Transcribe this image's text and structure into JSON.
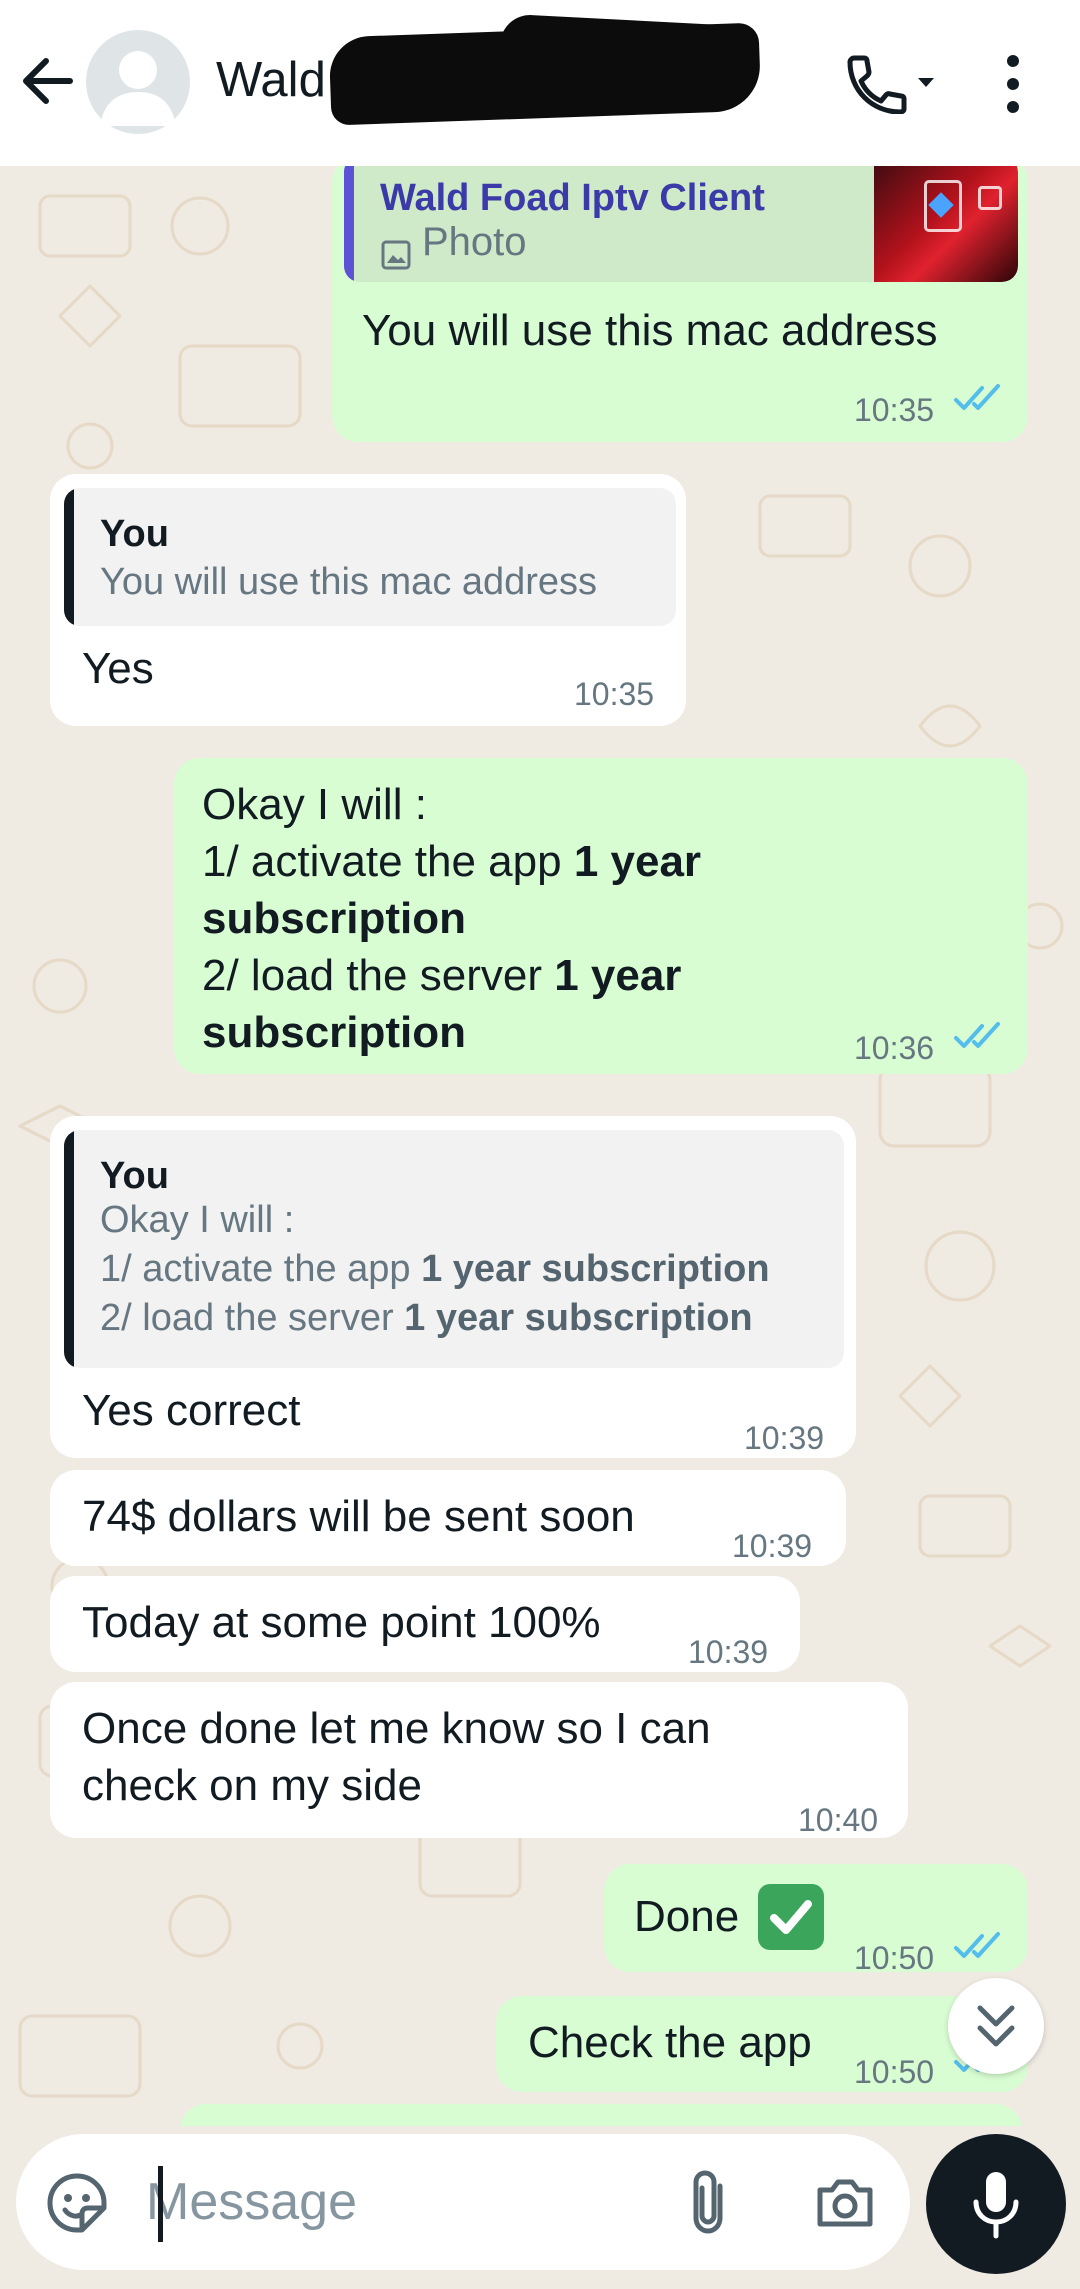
{
  "header": {
    "contact_name": "Wald Foad Iptv Client",
    "icons": [
      "back-arrow-icon",
      "avatar-icon",
      "call-icon",
      "more-vert-icon"
    ]
  },
  "messages": [
    {
      "direction": "out",
      "quote": {
        "author": "Wald Foad Iptv Client",
        "type_label": "Photo"
      },
      "text": "You will use this mac address",
      "time": "10:35",
      "status": "read"
    },
    {
      "direction": "in",
      "quote": {
        "author": "You",
        "text": "You will use this mac address"
      },
      "text": "Yes",
      "time": "10:35"
    },
    {
      "direction": "out",
      "lines": [
        {
          "plain": "Okay I will :",
          "bold": ""
        },
        {
          "plain": "1/ activate the app ",
          "bold": "1 year"
        },
        {
          "plain": "",
          "bold": "subscription"
        },
        {
          "plain": "2/ load the server ",
          "bold": "1 year"
        },
        {
          "plain": "",
          "bold": "subscription"
        }
      ],
      "time": "10:36",
      "status": "read"
    },
    {
      "direction": "in",
      "quote": {
        "author": "You",
        "line1": "Okay I will :",
        "line2_plain": "1/ activate the app ",
        "line2_bold": "1 year subscription",
        "line3_plain": "2/ load the server ",
        "line3_bold": "1 year subscription"
      },
      "text": "Yes correct",
      "time": "10:39"
    },
    {
      "direction": "in",
      "text": "74$ dollars will be sent soon",
      "time": "10:39"
    },
    {
      "direction": "in",
      "text": "Today at some point 100%",
      "time": "10:39"
    },
    {
      "direction": "in",
      "lines": [
        "Once done let me know so I can",
        "check on my side"
      ],
      "time": "10:40"
    },
    {
      "direction": "out",
      "text": "Done",
      "emoji": "check-mark-button-icon",
      "time": "10:50",
      "status": "read"
    },
    {
      "direction": "out",
      "text": "Check the app",
      "time": "10:50",
      "status": "read"
    }
  ],
  "composer": {
    "placeholder": "Message",
    "icons": [
      "sticker-icon",
      "attach-icon",
      "camera-icon",
      "mic-icon"
    ]
  },
  "colors": {
    "outgoing_bubble": "#d9fdd3",
    "incoming_bubble": "#ffffff",
    "chat_background": "#efeae2",
    "read_ticks": "#53bdeb",
    "timestamp": "#667781"
  }
}
